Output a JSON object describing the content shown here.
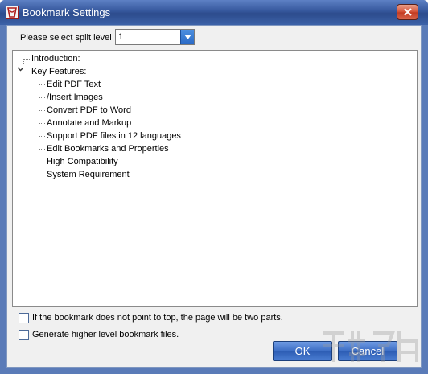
{
  "window": {
    "title": "Bookmark Settings"
  },
  "split_level": {
    "label": "Please select split level",
    "value": "1"
  },
  "tree": {
    "root_items": [
      {
        "label": "Introduction:",
        "expanded": false
      },
      {
        "label": "Key Features:",
        "expanded": true
      }
    ],
    "children": [
      "Edit PDF Text",
      "/Insert Images",
      "Convert PDF to Word",
      "Annotate and Markup",
      "Support PDF files in 12 languages",
      "Edit Bookmarks and Properties",
      "High Compatibility",
      "System Requirement"
    ]
  },
  "options": {
    "two_parts": {
      "label": "If the bookmark does not point to top, the page will be two parts.",
      "checked": false
    },
    "higher_level": {
      "label": "Generate higher level bookmark files.",
      "checked": false
    }
  },
  "buttons": {
    "ok": "OK",
    "cancel": "Cancel"
  },
  "colors": {
    "title_bar": "#35579c",
    "button": "#3e6fc5",
    "close": "#d8593f"
  }
}
